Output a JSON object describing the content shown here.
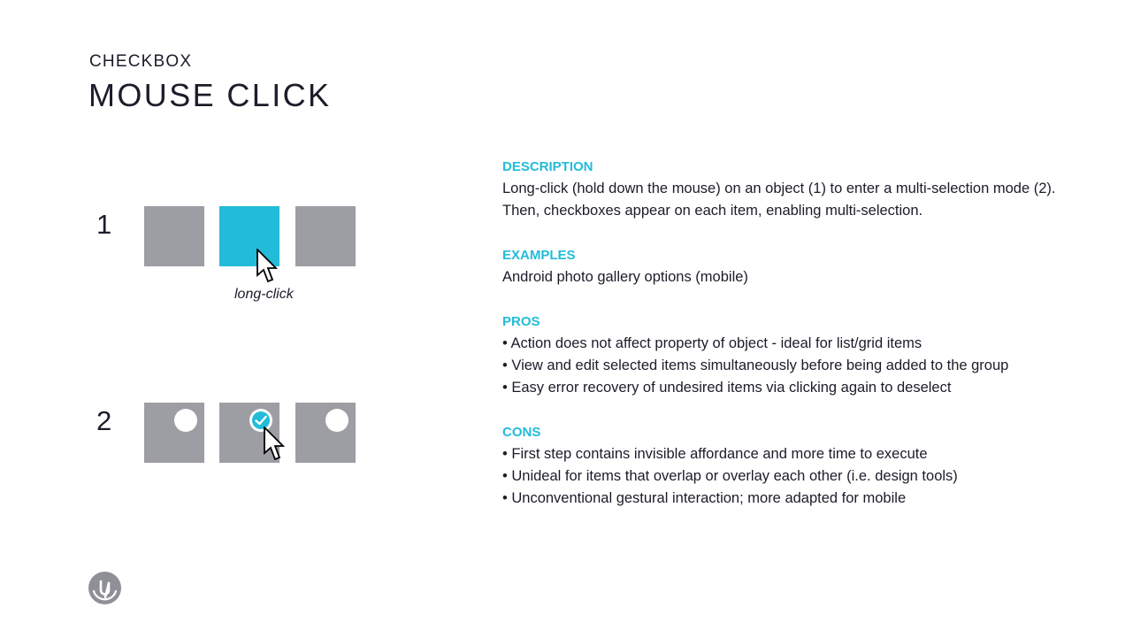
{
  "header": {
    "subtitle": "CHECKBOX",
    "title": "MOUSE CLICK"
  },
  "illustration": {
    "step1_number": "1",
    "step2_number": "2",
    "caption": "long-click",
    "colors": {
      "tile": "#9d9da4",
      "accent": "#22bcd9"
    },
    "icons": [
      "cursor-icon",
      "checkmark-icon",
      "radio-circle-icon"
    ]
  },
  "description": {
    "heading": "DESCRIPTION",
    "lines": [
      "Long-click (hold down the mouse) on an object (1) to enter a multi-selection mode (2).",
      "Then, checkboxes appear on each item, enabling multi-selection."
    ]
  },
  "examples": {
    "heading": "EXAMPLES",
    "lines": [
      "Android photo gallery options (mobile)"
    ]
  },
  "pros": {
    "heading": "PROS",
    "lines": [
      "• Action does not affect property of object - ideal for list/grid items",
      "• View and edit selected items simultaneously before being added to the group",
      "• Easy error recovery of undesired items via clicking again to deselect"
    ]
  },
  "cons": {
    "heading": "CONS",
    "lines": [
      "• First step contains invisible affordance and more time to execute",
      "• Unideal for items that overlap or overlay each other (i.e. design tools)",
      "• Unconventional gestural interaction; more adapted for mobile"
    ]
  },
  "footer": {
    "logo_icon": "brand-logo-icon"
  }
}
